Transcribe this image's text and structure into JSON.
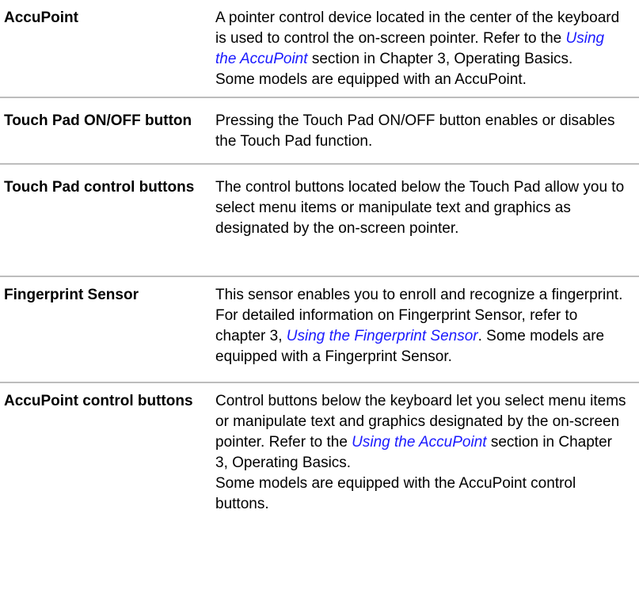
{
  "rows": [
    {
      "term": "AccuPoint",
      "desc": [
        {
          "t": "text",
          "v": "A pointer control device located in the center of the keyboard is used to control the on-screen pointer. Refer to the "
        },
        {
          "t": "link",
          "v": "Using the AccuPoint"
        },
        {
          "t": "text",
          "v": " section in Chapter 3, Operating Basics."
        },
        {
          "t": "br"
        },
        {
          "t": "text",
          "v": "Some models are equipped with an AccuPoint."
        }
      ]
    },
    {
      "term": "Touch Pad ON/OFF button",
      "desc": [
        {
          "t": "text",
          "v": "Pressing the Touch Pad ON/OFF button enables or disables the Touch Pad function."
        }
      ]
    },
    {
      "term": "Touch Pad control buttons",
      "desc": [
        {
          "t": "text",
          "v": "The control buttons located below the Touch Pad allow you to select menu items or manipulate text and graphics as designated by the on-screen pointer."
        }
      ]
    },
    {
      "term": "Fingerprint Sensor",
      "desc": [
        {
          "t": "text",
          "v": "This sensor enables you to enroll and recognize a fingerprint. For detailed information on Fingerprint Sensor, refer to chapter 3, "
        },
        {
          "t": "link",
          "v": "Using the Fingerprint Sensor"
        },
        {
          "t": "text",
          "v": ". Some models are equipped with a Fingerprint Sensor."
        }
      ]
    },
    {
      "term": "AccuPoint control buttons",
      "desc": [
        {
          "t": "text",
          "v": "Control buttons below the keyboard let you select menu items or manipulate text and graphics designated by the on-screen pointer. Refer to the "
        },
        {
          "t": "link",
          "v": "Using the AccuPoint"
        },
        {
          "t": "text",
          "v": " section in Chapter 3, Operating Basics."
        },
        {
          "t": "br"
        },
        {
          "t": "text",
          "v": "Some models are equipped with the AccuPoint control buttons."
        }
      ]
    }
  ],
  "colors": {
    "link": "#1a1aff",
    "divider": "#bdbdbd",
    "text": "#000000"
  }
}
